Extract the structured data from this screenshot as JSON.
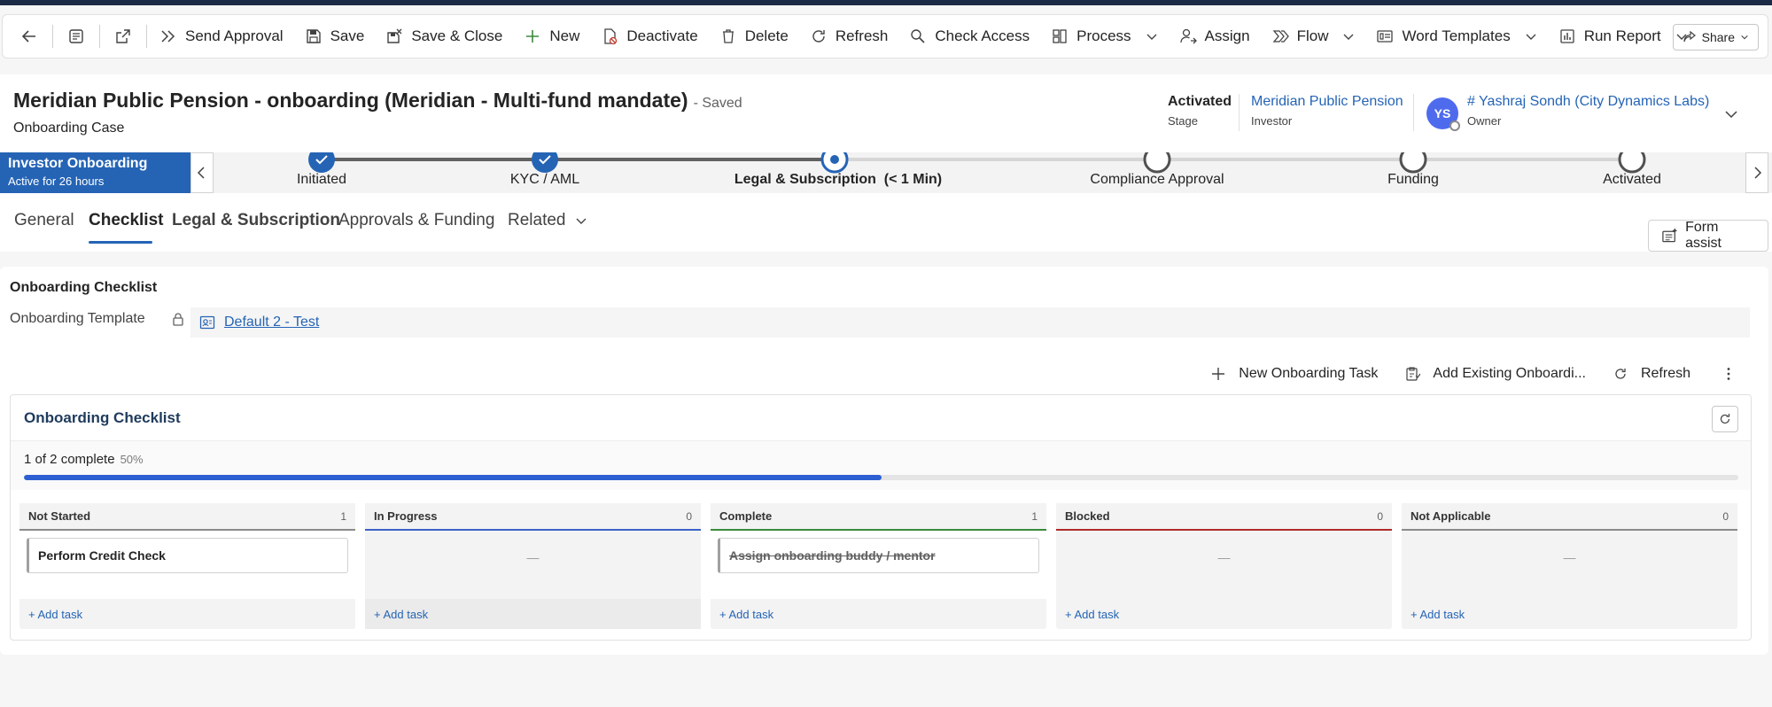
{
  "commandbar": {
    "items": [
      {
        "label": "Send Approval"
      },
      {
        "label": "Save"
      },
      {
        "label": "Save & Close"
      },
      {
        "label": "New"
      },
      {
        "label": "Deactivate"
      },
      {
        "label": "Delete"
      },
      {
        "label": "Refresh"
      },
      {
        "label": "Check Access"
      },
      {
        "label": "Process"
      },
      {
        "label": "Assign"
      },
      {
        "label": "Flow"
      },
      {
        "label": "Word Templates"
      },
      {
        "label": "Run Report"
      }
    ],
    "share_label": "Share"
  },
  "record": {
    "title": "Meridian Public Pension - onboarding (Meridian - Multi-fund mandate)",
    "save_state": "- Saved",
    "entity": "Onboarding Case"
  },
  "header_fields": {
    "stage_value": "Activated",
    "stage_label": "Stage",
    "investor_value": "Meridian Public Pension",
    "investor_label": "Investor",
    "owner_initials": "YS",
    "owner_value": "# Yashraj Sondh (City Dynamics Labs)",
    "owner_label": "Owner"
  },
  "process": {
    "name": "Investor Onboarding",
    "active_for": "Active for 26 hours",
    "stages": [
      {
        "label": "Initiated"
      },
      {
        "label": "KYC / AML"
      },
      {
        "label": "Legal & Subscription",
        "duration": "(< 1 Min)"
      },
      {
        "label": "Compliance Approval"
      },
      {
        "label": "Funding"
      },
      {
        "label": "Activated"
      }
    ]
  },
  "tabs": [
    "General",
    "Checklist",
    "Legal & Subscription",
    "Approvals & Funding",
    "Related"
  ],
  "form_assist_label": "Form assist",
  "checklist_section": {
    "title": "Onboarding Checklist",
    "template_label": "Onboarding Template",
    "template_value": "Default 2 - Test"
  },
  "subgrid_commands": {
    "new_task": "New Onboarding Task",
    "add_existing": "Add Existing Onboardi...",
    "refresh": "Refresh"
  },
  "board": {
    "title": "Onboarding Checklist",
    "progress_text": "1 of 2 complete",
    "progress_percent_text": "50%",
    "progress_fraction": 0.5,
    "empty_marker": "—",
    "add_task_label": "+ Add task",
    "columns": [
      {
        "name": "Not Started",
        "count": "1",
        "color": "#8a8a8a",
        "cards": [
          "Perform Credit Check"
        ]
      },
      {
        "name": "In Progress",
        "count": "0",
        "color": "#3a62c9",
        "cards": []
      },
      {
        "name": "Complete",
        "count": "1",
        "color": "#3b8a3b",
        "cards": [
          "Assign onboarding buddy / mentor"
        ]
      },
      {
        "name": "Blocked",
        "count": "0",
        "color": "#b02a2a",
        "cards": []
      },
      {
        "name": "Not Applicable",
        "count": "0",
        "color": "#8a8a8a",
        "cards": []
      }
    ]
  }
}
